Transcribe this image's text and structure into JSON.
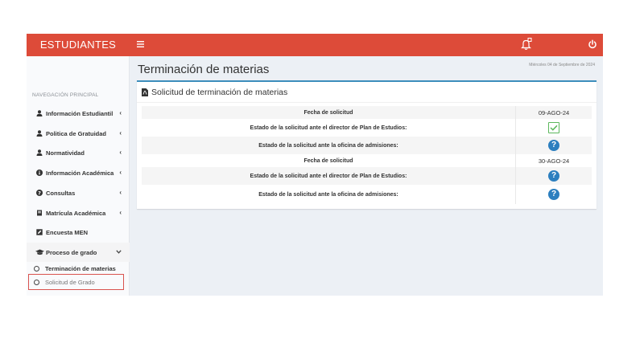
{
  "header": {
    "brand": "ESTUDIANTES",
    "menu_icon": "hamburger-icon",
    "notification_icon": "bell-icon",
    "power_icon": "power-icon"
  },
  "sidebar": {
    "section_header": "NAVEGACIÓN PRINCIPAL",
    "items": [
      {
        "label": "Información Estudiantil",
        "icon": "user-icon",
        "chevron": "‹"
      },
      {
        "label": "Politica de Gratuidad",
        "icon": "user-icon",
        "chevron": "‹"
      },
      {
        "label": "Normatividad",
        "icon": "user-icon",
        "chevron": "‹"
      },
      {
        "label": "Información Académica",
        "icon": "info-icon",
        "chevron": "‹"
      },
      {
        "label": "Consultas",
        "icon": "question-icon",
        "chevron": "‹"
      },
      {
        "label": "Matrícula Académica",
        "icon": "book-icon",
        "chevron": "‹"
      },
      {
        "label": "Encuesta MEN",
        "icon": "edit-icon",
        "chevron": ""
      },
      {
        "label": "Proceso de grado",
        "icon": "graduation-cap-icon",
        "chevron": "⌄"
      }
    ],
    "subitems": [
      {
        "label": "Terminación de materias"
      },
      {
        "label": "Solicitud de Grado"
      }
    ]
  },
  "content": {
    "title": "Terminación de materias",
    "date": "Miércoles 04 de Septiembre de 2024"
  },
  "box": {
    "title": "Solicitud de terminación de materias",
    "rows": [
      {
        "label": "Fecha de solicitud",
        "value": "09-AGO-24",
        "status": ""
      },
      {
        "label": "Estado de la solicitud ante el director de Plan de Estudios:",
        "value": "",
        "status": "check"
      },
      {
        "label": "Estado de la solicitud ante la oficina de admisiones:",
        "value": "",
        "status": "question"
      },
      {
        "label": "Fecha de solicitud",
        "value": "30-AGO-24",
        "status": ""
      },
      {
        "label": "Estado de la solicitud ante el director de Plan de Estudios:",
        "value": "",
        "status": "question"
      },
      {
        "label": "Estado de la solicitud ante la oficina de admisiones:",
        "value": "",
        "status": "question"
      }
    ]
  },
  "colors": {
    "topbar": "#dd4b39",
    "box_accent": "#3c8dbc",
    "check": "#5cb85c",
    "question": "#2c7fbf",
    "highlight": "#d9534f"
  }
}
